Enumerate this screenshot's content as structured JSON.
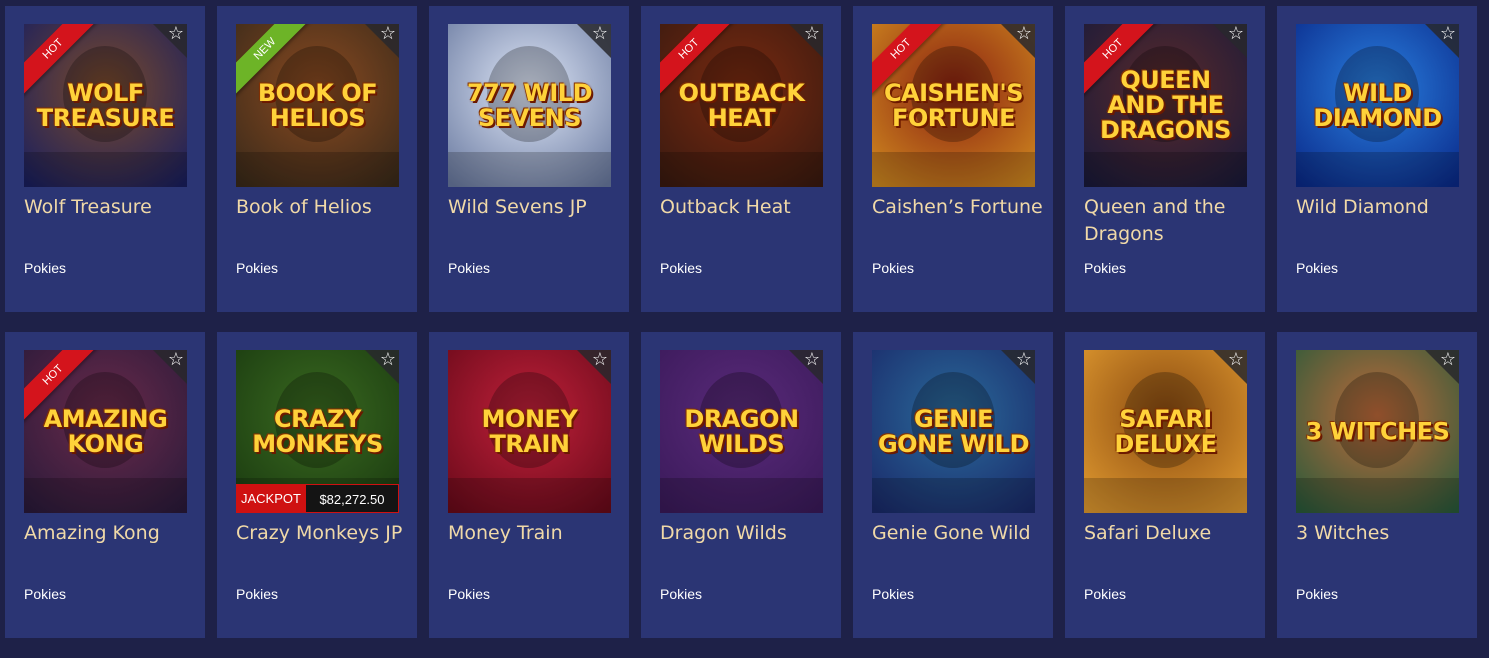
{
  "accent_colors": {
    "card_bg": "#2b3574",
    "page_bg": "#1e2148",
    "title": "#f0d9a8",
    "hot_ribbon": "#d4141c",
    "new_ribbon": "#6db427",
    "jackpot": "#cf1111"
  },
  "rows": [
    {
      "games": [
        {
          "title": "Wolf Treasure",
          "category": "Pokies",
          "badge": "HOT",
          "logo": "WOLF TREASURE",
          "art": "wolf",
          "icon": "star-icon",
          "bg1": "#1a1f5e",
          "bg2": "#7a4a2a"
        },
        {
          "title": "Book of Helios",
          "category": "Pokies",
          "badge": "NEW",
          "logo": "BOOK OF HELIOS",
          "art": "helios",
          "icon": "star-icon",
          "bg1": "#3a2a1a",
          "bg2": "#8a4a20"
        },
        {
          "title": "Wild Sevens JP",
          "category": "Pokies",
          "badge": "",
          "logo": "777 WILD SEVENS",
          "art": "sevens",
          "icon": "star-icon",
          "bg1": "#6a7aa0",
          "bg2": "#e0e8f8"
        },
        {
          "title": "Outback Heat",
          "category": "Pokies",
          "badge": "HOT",
          "logo": "OUTBACK HEAT",
          "art": "outback",
          "icon": "star-icon",
          "bg1": "#3a1a10",
          "bg2": "#7a2a10"
        },
        {
          "title": "Caishen’s Fortune",
          "category": "Pokies",
          "badge": "HOT",
          "logo": "Caishen's Fortune",
          "art": "caishen",
          "icon": "star-icon",
          "bg1": "#d08a20",
          "bg2": "#8a2010"
        },
        {
          "title": "Queen and the Dragons",
          "category": "Pokies",
          "badge": "HOT",
          "logo": "QUEEN and the DRAGONS",
          "art": "queen",
          "icon": "star-icon",
          "bg1": "#1a1a3a",
          "bg2": "#5a2a2a"
        },
        {
          "title": "Wild Diamond",
          "category": "Pokies",
          "badge": "",
          "logo": "WILD DIAMOND",
          "art": "diamond",
          "icon": "star-icon",
          "bg1": "#0a2a8a",
          "bg2": "#2a80e0"
        }
      ]
    },
    {
      "games": [
        {
          "title": "Amazing Kong",
          "category": "Pokies",
          "badge": "HOT",
          "logo": "AMAZING KONG",
          "art": "kong",
          "icon": "star-icon",
          "bg1": "#2a1a3a",
          "bg2": "#6a2a4a"
        },
        {
          "title": "Crazy Monkeys JP",
          "category": "Pokies",
          "badge": "",
          "logo": "CRAZY MONKEYS",
          "art": "monkeys",
          "icon": "star-icon",
          "bg1": "#1a3a10",
          "bg2": "#3a6a20",
          "jackpot_label": "JACKPOT",
          "jackpot_value": "$82,272.50"
        },
        {
          "title": "Money Train",
          "category": "Pokies",
          "badge": "",
          "logo": "MONEY TRAIN",
          "art": "train",
          "icon": "star-icon",
          "bg1": "#6a0a1a",
          "bg2": "#c0203a"
        },
        {
          "title": "Dragon Wilds",
          "category": "Pokies",
          "badge": "",
          "logo": "DRAGON WILDS",
          "art": "dragon",
          "icon": "star-icon",
          "bg1": "#3a1a5a",
          "bg2": "#5a2a7a"
        },
        {
          "title": "Genie Gone Wild",
          "category": "Pokies",
          "badge": "",
          "logo": "Genie Gone Wild",
          "art": "genie",
          "icon": "star-icon",
          "bg1": "#1a2a6a",
          "bg2": "#2a6a9a"
        },
        {
          "title": "Safari Deluxe",
          "category": "Pokies",
          "badge": "",
          "logo": "SAFARI DELUXE",
          "art": "safari",
          "icon": "star-icon",
          "bg1": "#e09a30",
          "bg2": "#8a4a10"
        },
        {
          "title": "3 Witches",
          "category": "Pokies",
          "badge": "",
          "logo": "3 WITCHES",
          "art": "witches",
          "icon": "star-icon",
          "bg1": "#2a5a3a",
          "bg2": "#c06a3a"
        }
      ]
    }
  ]
}
